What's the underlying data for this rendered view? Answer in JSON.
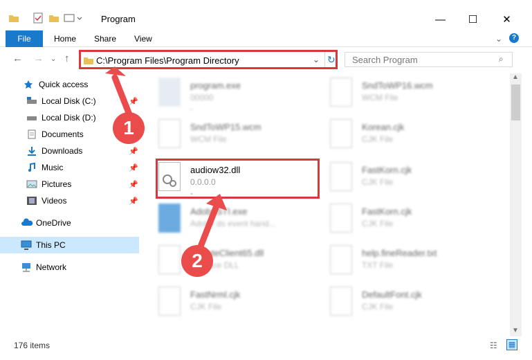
{
  "window": {
    "title": "Program"
  },
  "ribbon": {
    "tabs": [
      "File",
      "Home",
      "Share",
      "View"
    ]
  },
  "address": {
    "path": "C:\\Program Files\\Program Directory"
  },
  "search": {
    "placeholder": "Search Program"
  },
  "sidebar": {
    "items": [
      {
        "label": "Quick access",
        "icon": "star-icon"
      },
      {
        "label": "Local Disk (C:)",
        "icon": "drive-icon",
        "pinned": true
      },
      {
        "label": "Local Disk (D:)",
        "icon": "drive-icon"
      },
      {
        "label": "Documents",
        "icon": "documents-icon",
        "pinned": true
      },
      {
        "label": "Downloads",
        "icon": "download-icon",
        "pinned": true
      },
      {
        "label": "Music",
        "icon": "music-icon",
        "pinned": true
      },
      {
        "label": "Pictures",
        "icon": "pictures-icon",
        "pinned": true
      },
      {
        "label": "Videos",
        "icon": "video-icon",
        "pinned": true
      },
      {
        "label": "OneDrive",
        "icon": "cloud-icon"
      },
      {
        "label": "This PC",
        "icon": "pc-icon",
        "selected": true
      },
      {
        "label": "Network",
        "icon": "network-icon"
      }
    ]
  },
  "files": {
    "left": [
      {
        "name": "program.exe",
        "type": "00000",
        "extra": "-"
      },
      {
        "name": "SndToWP15.wcm",
        "type": "WCM File"
      },
      {
        "name": "audiow32.dll",
        "type": "0.0.0.0",
        "extra": "-"
      },
      {
        "name": "AdobeSTI.exe",
        "type": "Adobe ds event hand..."
      },
      {
        "name": "UpdateClient65.dll",
        "type": "Aplicace DLL"
      },
      {
        "name": "FastNrml.cjk",
        "type": "CJK File"
      }
    ],
    "right": [
      {
        "name": "SndToWP16.wcm",
        "type": "WCM File"
      },
      {
        "name": "Korean.cjk",
        "type": "CJK File"
      },
      {
        "name": "FastKorn.cjk",
        "type": "CJK File"
      },
      {
        "name": "FastKorn.cjk",
        "type": "CJK File"
      },
      {
        "name": "help.fineReader.txt",
        "type": "TXT File"
      },
      {
        "name": "DefaultFont.cjk",
        "type": "CJK File"
      }
    ]
  },
  "badges": [
    "1",
    "2"
  ],
  "status": {
    "count": "176 items"
  },
  "colors": {
    "accent": "#1979ca",
    "highlight": "#d9383a",
    "badge": "#ea4b4b"
  }
}
